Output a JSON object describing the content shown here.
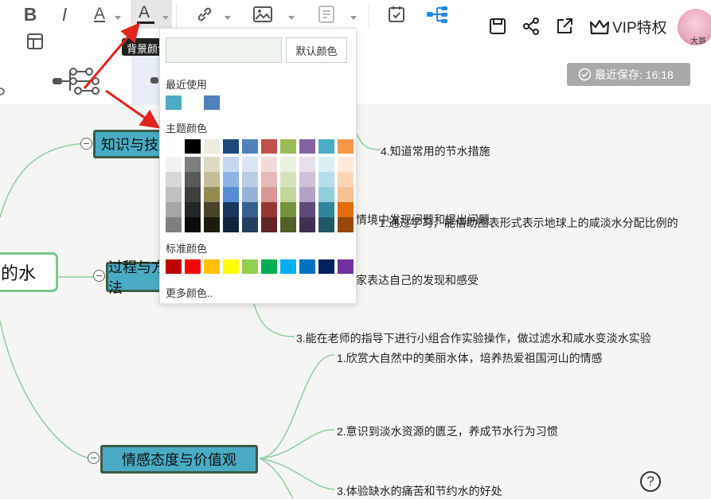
{
  "toolbar": {
    "bold": "B",
    "italic": "I",
    "font_color": "A",
    "bg_color": "A",
    "tooltip": "背景颜色",
    "vip_label": "VIP特权",
    "avatar_text": "大哥",
    "font_color_bar": "#000000",
    "bg_color_bar": "#1f1f1f"
  },
  "save_status": "最近保存: 16:18",
  "popup": {
    "default_label": "默认颜色",
    "recent_label": "最近使用",
    "theme_label": "主题颜色",
    "standard_label": "标准颜色",
    "more_label": "更多颜色..",
    "preview_color": "#eef5ee",
    "recent": [
      "#4bacc6",
      "#ffffff",
      "#4f81bd"
    ],
    "theme_top": [
      "#ffffff",
      "#000000",
      "#eeece1",
      "#1f497d",
      "#4f81bd",
      "#c0504d",
      "#9bbb59",
      "#8064a2",
      "#4bacc6",
      "#f79646"
    ],
    "theme_shades": [
      [
        "#f2f2f2",
        "#7f7f7f",
        "#ddd9c3",
        "#c6d9f0",
        "#dbe5f1",
        "#f2dcdb",
        "#ebf1dd",
        "#e5e0ec",
        "#dbeef3",
        "#fdeada"
      ],
      [
        "#d8d8d8",
        "#595959",
        "#c4bd97",
        "#8db3e2",
        "#b8cce4",
        "#e5b9b7",
        "#d7e3bc",
        "#ccc1d9",
        "#b7dde8",
        "#fbd5b5"
      ],
      [
        "#bfbfbf",
        "#3f3f3f",
        "#938953",
        "#548dd4",
        "#95b3d7",
        "#d99694",
        "#c3d69b",
        "#b2a2c7",
        "#92cddc",
        "#fac08f"
      ],
      [
        "#a5a5a5",
        "#262626",
        "#494429",
        "#17365d",
        "#366092",
        "#953734",
        "#76923c",
        "#5f497a",
        "#31859b",
        "#e36c09"
      ],
      [
        "#7f7f7f",
        "#0c0c0c",
        "#1d1b10",
        "#0f243e",
        "#244061",
        "#632423",
        "#4f6128",
        "#3f3151",
        "#205867",
        "#974806"
      ]
    ],
    "standard": [
      "#c00000",
      "#ff0000",
      "#ffc000",
      "#ffff00",
      "#92d050",
      "#00b050",
      "#00b0f0",
      "#0070c0",
      "#002060",
      "#7030a0"
    ]
  },
  "mindmap": {
    "root": "的水",
    "knowledge": "知识与技能",
    "process": "过程与方法",
    "emotion": "情感态度与价值观",
    "leaves": {
      "k4": "4.知道常用的节水措施",
      "overlap_a": "情境中发现问题和提出问题",
      "overlap_b": "1.通过学习，能借助图表形式表示地球上的咸淡水分配比例的",
      "p2": "家表达自己的发现和感受",
      "p3": "3.能在老师的指导下进行小组合作实验操作，做过滤水和咸水变淡水实验",
      "e1": "1.欣赏大自然中的美丽水体，培养热爱祖国河山的情感",
      "e2": "2.意识到淡水资源的匮乏，养成节水行为习惯",
      "e3": "3.体验缺水的痛苦和节约水的好处"
    }
  },
  "help": "?"
}
